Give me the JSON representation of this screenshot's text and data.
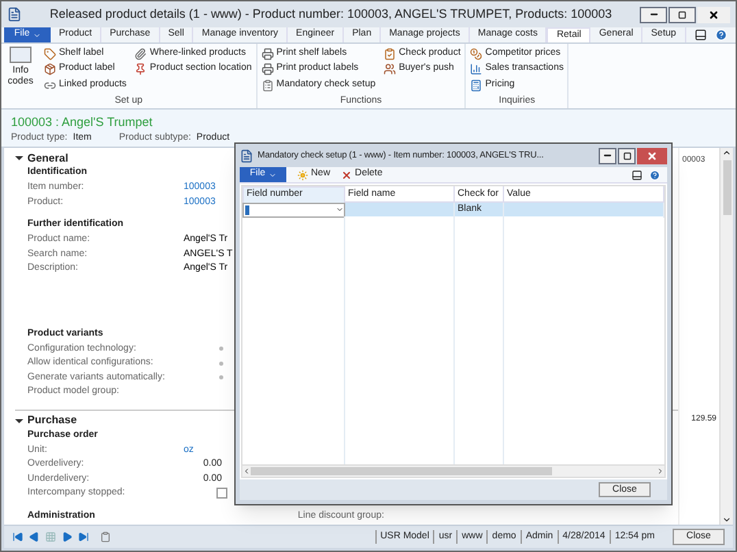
{
  "window": {
    "title": "Released product details (1 - www) - Product number: 100003, ANGEL'S TRUMPET, Products: 100003"
  },
  "ribbon": {
    "file": "File",
    "tabs": [
      {
        "label": "Product",
        "selected": false
      },
      {
        "label": "Purchase",
        "selected": false
      },
      {
        "label": "Sell",
        "selected": false
      },
      {
        "label": "Manage inventory",
        "selected": false
      },
      {
        "label": "Engineer",
        "selected": false
      },
      {
        "label": "Plan",
        "selected": false
      },
      {
        "label": "Manage projects",
        "selected": false
      },
      {
        "label": "Manage costs",
        "selected": false
      },
      {
        "label": "Retail",
        "selected": true
      },
      {
        "label": "General",
        "selected": false
      },
      {
        "label": "Setup",
        "selected": false
      }
    ],
    "large_button": {
      "label": "Info codes"
    },
    "groups": [
      {
        "label": "Set up",
        "columns": [
          [
            {
              "label": "Shelf label"
            },
            {
              "label": "Product label"
            },
            {
              "label": "Linked products"
            }
          ],
          [
            {
              "label": "Where-linked products"
            },
            {
              "label": "Product section location"
            }
          ]
        ]
      },
      {
        "label": "Functions",
        "columns": [
          [
            {
              "label": "Print shelf labels"
            },
            {
              "label": "Print product labels"
            },
            {
              "label": "Mandatory check setup"
            }
          ],
          [
            {
              "label": "Check product"
            },
            {
              "label": "Buyer's push"
            }
          ]
        ]
      },
      {
        "label": "Inquiries",
        "columns": [
          [
            {
              "label": "Competitor prices"
            },
            {
              "label": "Sales transactions"
            },
            {
              "label": "Pricing"
            }
          ]
        ]
      }
    ]
  },
  "header": {
    "title": "100003 : Angel'S Trumpet",
    "fields": [
      {
        "label": "Product type:",
        "value": "Item"
      },
      {
        "label": "Product subtype:",
        "value": "Product"
      }
    ]
  },
  "sections": [
    {
      "title": "General",
      "expanded": true,
      "groups": [
        {
          "title": "Identification",
          "fields": [
            {
              "label": "Item number:",
              "kind": "link",
              "value": "100003"
            },
            {
              "label": "Product:",
              "kind": "link",
              "value": "100003"
            }
          ]
        },
        {
          "title": "Further identification",
          "fields": [
            {
              "label": "Product name:",
              "kind": "text",
              "value": "Angel'S Tr"
            },
            {
              "label": "Search name:",
              "kind": "text",
              "value": "ANGEL'S T"
            },
            {
              "label": "Description:",
              "kind": "text",
              "value": "Angel'S Tr"
            }
          ]
        },
        {
          "title": "Product variants",
          "fields": [
            {
              "label": "Configuration technology:",
              "kind": "dot"
            },
            {
              "label": "Allow identical configurations:",
              "kind": "dot"
            },
            {
              "label": "Generate variants automatically:",
              "kind": "dot"
            },
            {
              "label": "Product model group:",
              "kind": "text"
            }
          ]
        }
      ]
    },
    {
      "title": "Purchase",
      "expanded": true,
      "groups": [
        {
          "title": "Purchase order",
          "fields": [
            {
              "label": "Unit:",
              "kind": "link",
              "value": "oz"
            },
            {
              "label": "Overdelivery:",
              "kind": "number",
              "value": "0.00"
            },
            {
              "label": "Underdelivery:",
              "kind": "number",
              "value": "0.00"
            },
            {
              "label": "Intercompany stopped:",
              "kind": "checkbox",
              "checked": false
            }
          ]
        },
        {
          "title": "Administration"
        }
      ]
    }
  ],
  "right_column": {
    "values": [
      "00003",
      "129.59"
    ],
    "label": "Line discount group:"
  },
  "status_bar": {
    "items": [
      "USR Model",
      "usr",
      "www",
      "demo",
      "Admin",
      "4/28/2014",
      "12:54 pm"
    ],
    "close": "Close"
  },
  "dialog": {
    "title": "Mandatory check setup (1 - www) - Item number: 100003, ANGEL'S TRU...",
    "file": "File",
    "actions": [
      {
        "label": "New"
      },
      {
        "label": "Delete"
      }
    ],
    "columns": [
      "Field number",
      "Field name",
      "Check for",
      "Value"
    ],
    "rows": [
      {
        "selected": true,
        "cells": [
          "",
          "",
          "Blank",
          ""
        ]
      }
    ],
    "close": "Close"
  }
}
